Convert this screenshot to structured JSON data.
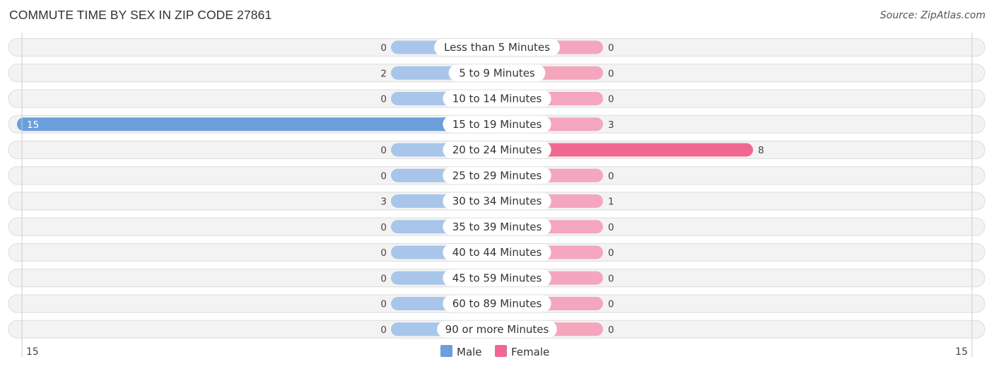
{
  "header": {
    "title": "COMMUTE TIME BY SEX IN ZIP CODE 27861",
    "source": "Source: ZipAtlas.com"
  },
  "chart_data": {
    "type": "bar",
    "orientation": "horizontal-diverging",
    "title": "COMMUTE TIME BY SEX IN ZIP CODE 27861",
    "categories": [
      "Less than 5 Minutes",
      "5 to 9 Minutes",
      "10 to 14 Minutes",
      "15 to 19 Minutes",
      "20 to 24 Minutes",
      "25 to 29 Minutes",
      "30 to 34 Minutes",
      "35 to 39 Minutes",
      "40 to 44 Minutes",
      "45 to 59 Minutes",
      "60 to 89 Minutes",
      "90 or more Minutes"
    ],
    "series": [
      {
        "name": "Male",
        "color": "#6a9fdc",
        "light_color": "#a8c6ea",
        "values": [
          0,
          2,
          0,
          15,
          0,
          0,
          3,
          0,
          0,
          0,
          0,
          0
        ]
      },
      {
        "name": "Female",
        "color": "#f06892",
        "light_color": "#f5a6bf",
        "values": [
          0,
          0,
          0,
          3,
          8,
          0,
          1,
          0,
          0,
          0,
          0,
          0
        ]
      }
    ],
    "axis": {
      "left_label": "15",
      "right_label": "15",
      "max": 15
    },
    "legend": {
      "position": "bottom-center",
      "items": [
        "Male",
        "Female"
      ]
    }
  }
}
